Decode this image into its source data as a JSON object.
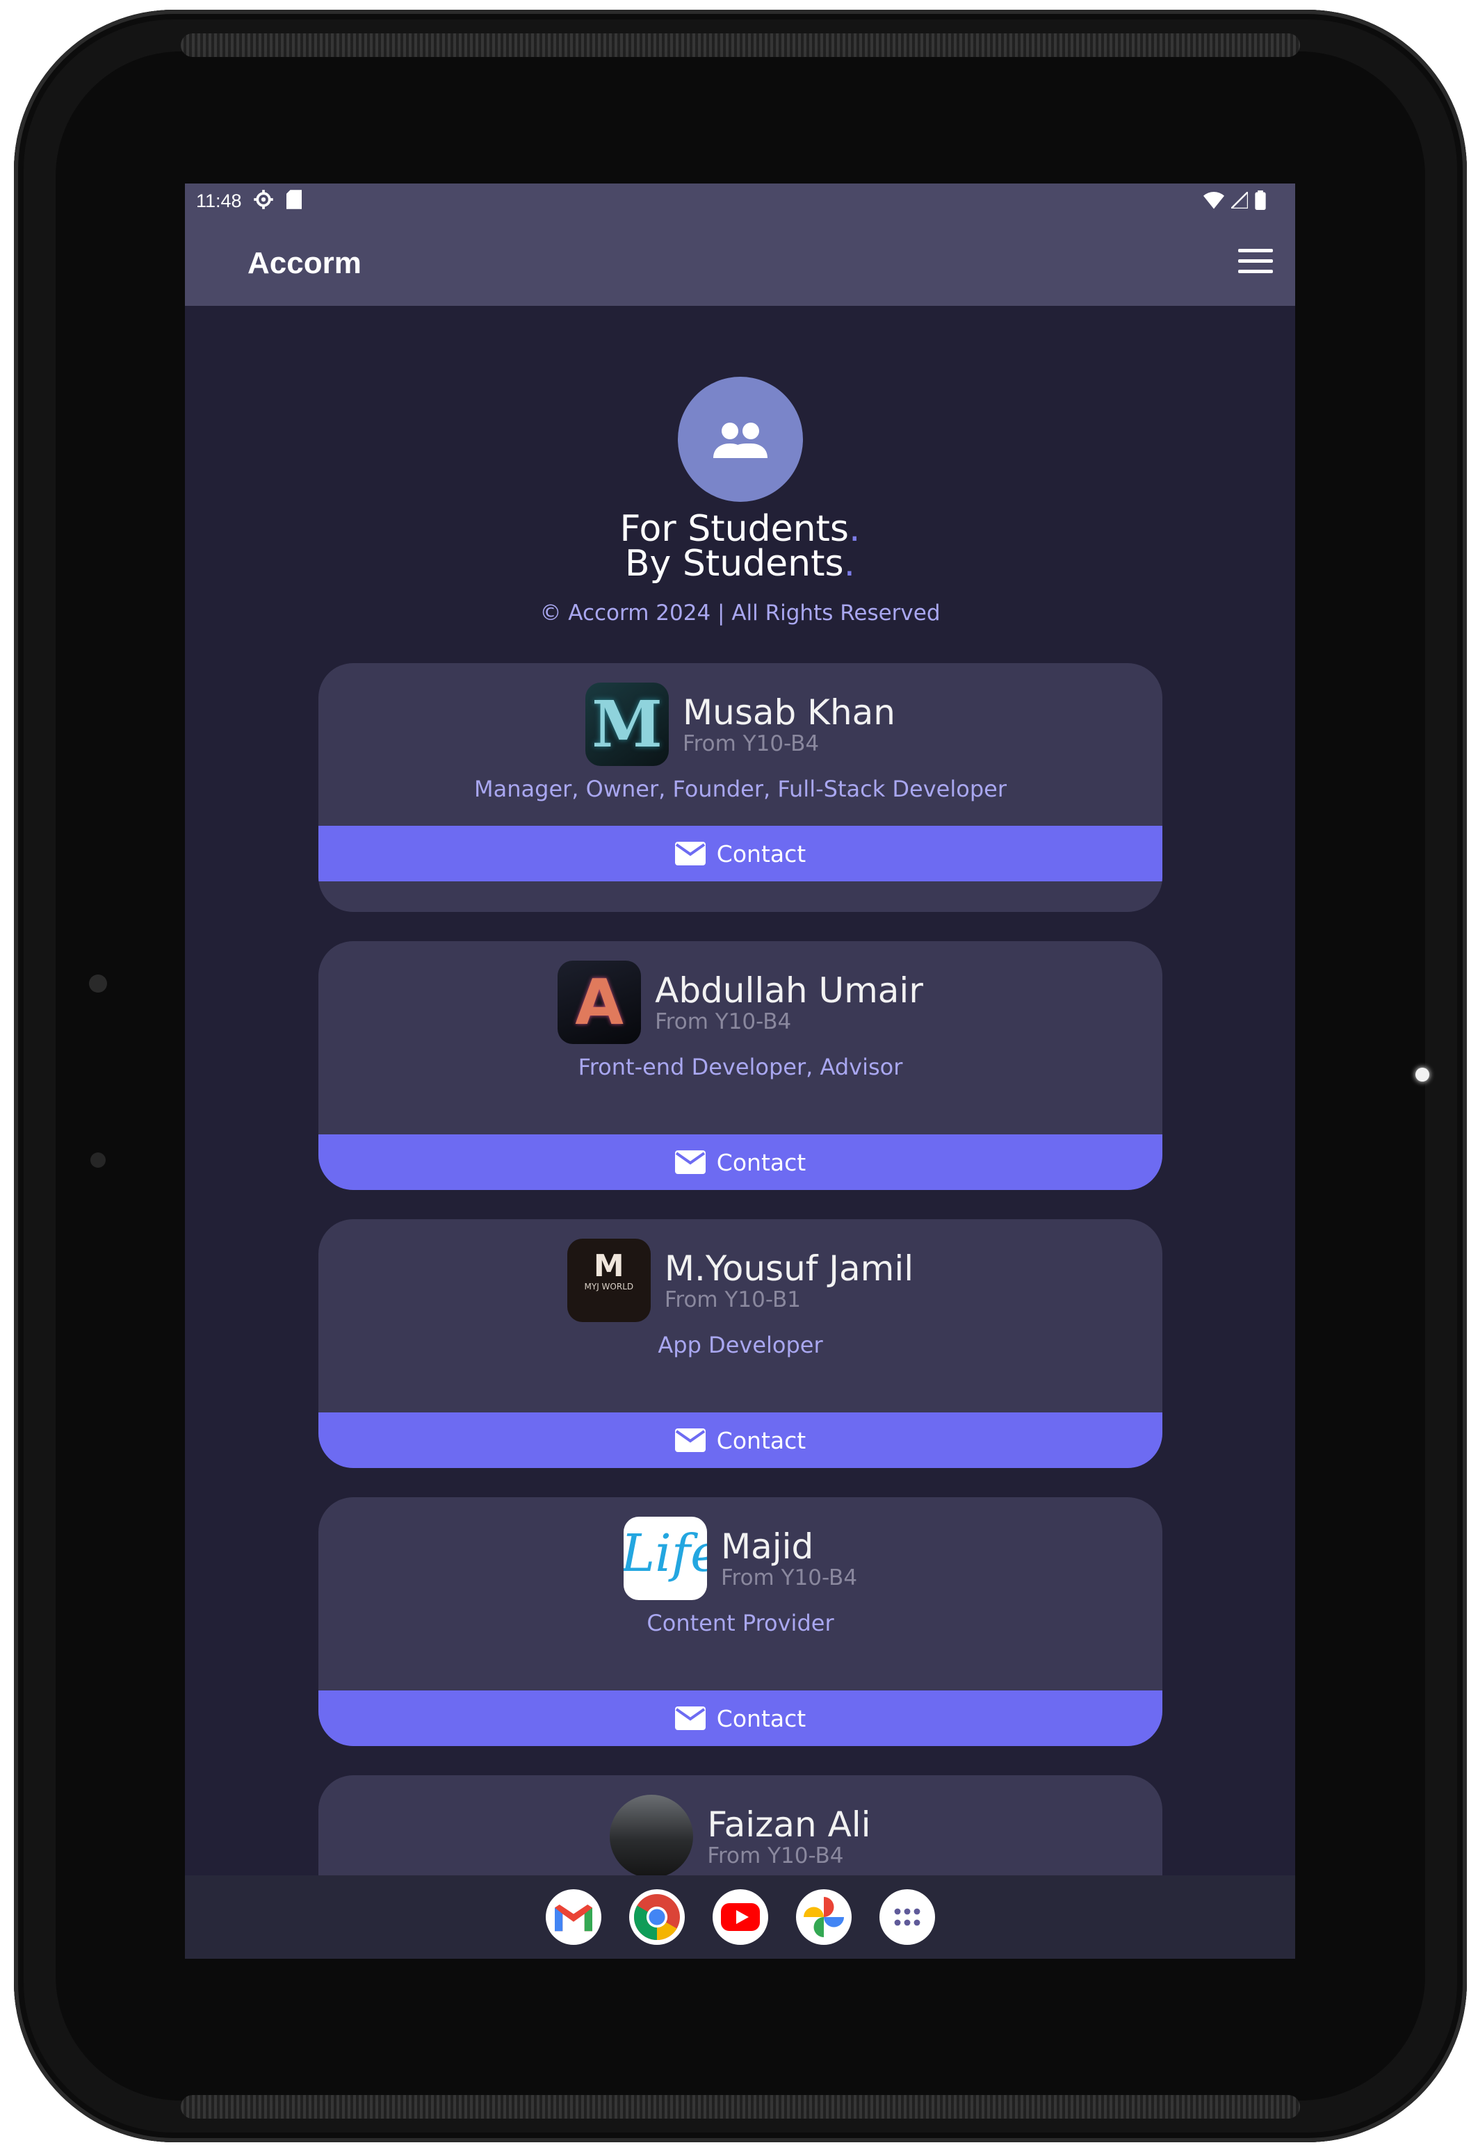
{
  "status_bar": {
    "time": "11:48"
  },
  "app_bar": {
    "title": "Accorm"
  },
  "hero": {
    "line1": "For Students",
    "line2": "By Students",
    "dot": ".",
    "copyright": "© Accorm 2024 | All Rights Reserved"
  },
  "team": [
    {
      "name": "Musab Khan",
      "from": "From Y10-B4",
      "role": "Manager, Owner, Founder, Full-Stack Developer",
      "contact_label": "Contact",
      "logo_letter": "M"
    },
    {
      "name": "Abdullah Umair",
      "from": "From Y10-B4",
      "role": "Front-end Developer, Advisor",
      "contact_label": "Contact",
      "logo_letter": "A"
    },
    {
      "name": "M.Yousuf Jamil",
      "from": "From Y10-B1",
      "role": "App Developer",
      "contact_label": "Contact",
      "logo_letter": "M",
      "logo_text": "MYJ WORLD"
    },
    {
      "name": "Majid",
      "from": "From Y10-B4",
      "role": "Content Provider",
      "contact_label": "Contact",
      "logo_text": "Life"
    },
    {
      "name": "Faizan Ali",
      "from": "From Y10-B4"
    }
  ],
  "dock": [
    "Gmail",
    "Chrome",
    "YouTube",
    "Photos",
    "App drawer"
  ],
  "colors": {
    "accent": "#6d6bf2",
    "background": "#222036",
    "card": "#3b3955",
    "appbar": "#4b4967"
  }
}
